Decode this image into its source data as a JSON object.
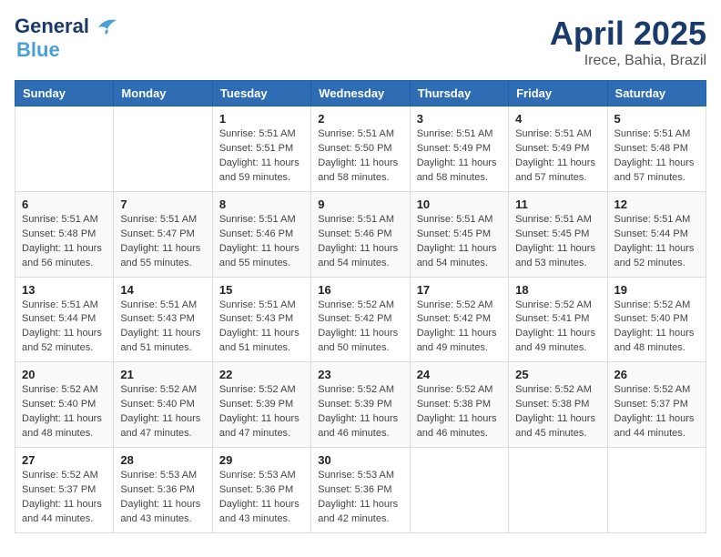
{
  "header": {
    "logo_line1": "General",
    "logo_line2": "Blue",
    "month": "April 2025",
    "location": "Irece, Bahia, Brazil"
  },
  "weekdays": [
    "Sunday",
    "Monday",
    "Tuesday",
    "Wednesday",
    "Thursday",
    "Friday",
    "Saturday"
  ],
  "weeks": [
    [
      null,
      null,
      {
        "day": 1,
        "sunrise": "5:51 AM",
        "sunset": "5:51 PM",
        "daylight": "11 hours and 59 minutes."
      },
      {
        "day": 2,
        "sunrise": "5:51 AM",
        "sunset": "5:50 PM",
        "daylight": "11 hours and 58 minutes."
      },
      {
        "day": 3,
        "sunrise": "5:51 AM",
        "sunset": "5:49 PM",
        "daylight": "11 hours and 58 minutes."
      },
      {
        "day": 4,
        "sunrise": "5:51 AM",
        "sunset": "5:49 PM",
        "daylight": "11 hours and 57 minutes."
      },
      {
        "day": 5,
        "sunrise": "5:51 AM",
        "sunset": "5:48 PM",
        "daylight": "11 hours and 57 minutes."
      }
    ],
    [
      {
        "day": 6,
        "sunrise": "5:51 AM",
        "sunset": "5:48 PM",
        "daylight": "11 hours and 56 minutes."
      },
      {
        "day": 7,
        "sunrise": "5:51 AM",
        "sunset": "5:47 PM",
        "daylight": "11 hours and 55 minutes."
      },
      {
        "day": 8,
        "sunrise": "5:51 AM",
        "sunset": "5:46 PM",
        "daylight": "11 hours and 55 minutes."
      },
      {
        "day": 9,
        "sunrise": "5:51 AM",
        "sunset": "5:46 PM",
        "daylight": "11 hours and 54 minutes."
      },
      {
        "day": 10,
        "sunrise": "5:51 AM",
        "sunset": "5:45 PM",
        "daylight": "11 hours and 54 minutes."
      },
      {
        "day": 11,
        "sunrise": "5:51 AM",
        "sunset": "5:45 PM",
        "daylight": "11 hours and 53 minutes."
      },
      {
        "day": 12,
        "sunrise": "5:51 AM",
        "sunset": "5:44 PM",
        "daylight": "11 hours and 52 minutes."
      }
    ],
    [
      {
        "day": 13,
        "sunrise": "5:51 AM",
        "sunset": "5:44 PM",
        "daylight": "11 hours and 52 minutes."
      },
      {
        "day": 14,
        "sunrise": "5:51 AM",
        "sunset": "5:43 PM",
        "daylight": "11 hours and 51 minutes."
      },
      {
        "day": 15,
        "sunrise": "5:51 AM",
        "sunset": "5:43 PM",
        "daylight": "11 hours and 51 minutes."
      },
      {
        "day": 16,
        "sunrise": "5:52 AM",
        "sunset": "5:42 PM",
        "daylight": "11 hours and 50 minutes."
      },
      {
        "day": 17,
        "sunrise": "5:52 AM",
        "sunset": "5:42 PM",
        "daylight": "11 hours and 49 minutes."
      },
      {
        "day": 18,
        "sunrise": "5:52 AM",
        "sunset": "5:41 PM",
        "daylight": "11 hours and 49 minutes."
      },
      {
        "day": 19,
        "sunrise": "5:52 AM",
        "sunset": "5:40 PM",
        "daylight": "11 hours and 48 minutes."
      }
    ],
    [
      {
        "day": 20,
        "sunrise": "5:52 AM",
        "sunset": "5:40 PM",
        "daylight": "11 hours and 48 minutes."
      },
      {
        "day": 21,
        "sunrise": "5:52 AM",
        "sunset": "5:40 PM",
        "daylight": "11 hours and 47 minutes."
      },
      {
        "day": 22,
        "sunrise": "5:52 AM",
        "sunset": "5:39 PM",
        "daylight": "11 hours and 47 minutes."
      },
      {
        "day": 23,
        "sunrise": "5:52 AM",
        "sunset": "5:39 PM",
        "daylight": "11 hours and 46 minutes."
      },
      {
        "day": 24,
        "sunrise": "5:52 AM",
        "sunset": "5:38 PM",
        "daylight": "11 hours and 46 minutes."
      },
      {
        "day": 25,
        "sunrise": "5:52 AM",
        "sunset": "5:38 PM",
        "daylight": "11 hours and 45 minutes."
      },
      {
        "day": 26,
        "sunrise": "5:52 AM",
        "sunset": "5:37 PM",
        "daylight": "11 hours and 44 minutes."
      }
    ],
    [
      {
        "day": 27,
        "sunrise": "5:52 AM",
        "sunset": "5:37 PM",
        "daylight": "11 hours and 44 minutes."
      },
      {
        "day": 28,
        "sunrise": "5:53 AM",
        "sunset": "5:36 PM",
        "daylight": "11 hours and 43 minutes."
      },
      {
        "day": 29,
        "sunrise": "5:53 AM",
        "sunset": "5:36 PM",
        "daylight": "11 hours and 43 minutes."
      },
      {
        "day": 30,
        "sunrise": "5:53 AM",
        "sunset": "5:36 PM",
        "daylight": "11 hours and 42 minutes."
      },
      null,
      null,
      null
    ]
  ]
}
